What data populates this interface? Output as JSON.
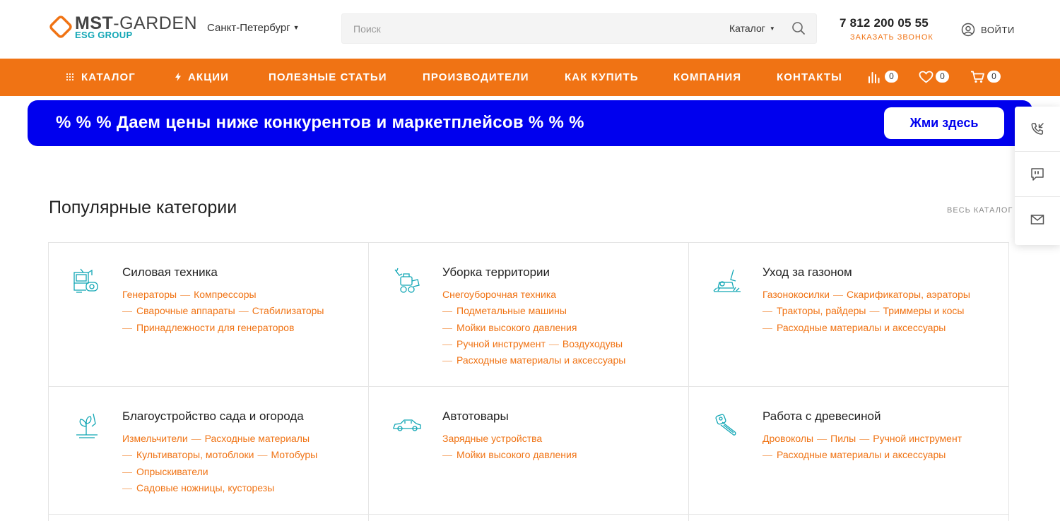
{
  "header": {
    "logo_main_bold": "MST",
    "logo_main_light": "-GARDEN",
    "logo_sub": "ESG GROUP",
    "city": "Санкт-Петербург",
    "search_placeholder": "Поиск",
    "search_category": "Каталог",
    "phone": "7 812 200 05 55",
    "callback": "ЗАКАЗАТЬ ЗВОНОК",
    "login": "ВОЙТИ"
  },
  "nav": {
    "items": [
      {
        "label": "КАТАЛОГ",
        "icon": "grid-dots-icon"
      },
      {
        "label": "АКЦИИ",
        "icon": "lightning-icon"
      },
      {
        "label": "ПОЛЕЗНЫЕ СТАТЬИ"
      },
      {
        "label": "ПРОИЗВОДИТЕЛИ"
      },
      {
        "label": "КАК КУПИТЬ"
      },
      {
        "label": "КОМПАНИЯ"
      },
      {
        "label": "КОНТАКТЫ"
      }
    ],
    "compare_count": "0",
    "favorites_count": "0",
    "cart_count": "0"
  },
  "banner": {
    "text": "% % % Даем цены ниже конкурентов и маркетплейсов % % %",
    "button": "Жми здесь"
  },
  "section": {
    "title": "Популярные категории",
    "all_link": "ВЕСЬ КАТАЛОГ"
  },
  "categories": [
    {
      "title": "Силовая техника",
      "icon": "generator-icon",
      "links": [
        [
          "Генераторы",
          "Компрессоры"
        ],
        [
          "Сварочные аппараты",
          "Стабилизаторы"
        ],
        [
          "Принадлежности для генераторов"
        ]
      ]
    },
    {
      "title": "Уборка территории",
      "icon": "snow-blower-icon",
      "links": [
        [
          "Снегоуборочная техника"
        ],
        [
          "Подметальные машины"
        ],
        [
          "Мойки высокого давления"
        ],
        [
          "Ручной инструмент",
          "Воздуходувы"
        ],
        [
          "Расходные материалы и аксессуары"
        ]
      ]
    },
    {
      "title": "Уход за газоном",
      "icon": "lawn-mower-icon",
      "links": [
        [
          "Газонокосилки",
          "Скарификаторы, аэраторы"
        ],
        [
          "Тракторы, райдеры",
          "Триммеры и косы"
        ],
        [
          "Расходные материалы и аксессуары"
        ]
      ]
    },
    {
      "title": "Благоустройство сада и огорода",
      "icon": "garden-plant-icon",
      "links": [
        [
          "Измельчители",
          "Расходные материалы"
        ],
        [
          "Культиваторы, мотоблоки",
          "Мотобуры"
        ],
        [
          "Опрыскиватели"
        ],
        [
          "Садовые ножницы, кусторезы"
        ]
      ]
    },
    {
      "title": "Автотовары",
      "icon": "car-icon",
      "links": [
        [
          "Зарядные устройства"
        ],
        [
          "Мойки высокого давления"
        ]
      ]
    },
    {
      "title": "Работа с древесиной",
      "icon": "chainsaw-icon",
      "links": [
        [
          "Дровоколы",
          "Пилы",
          "Ручной инструмент"
        ],
        [
          "Расходные материалы и аксессуары"
        ]
      ]
    }
  ],
  "colors": {
    "accent": "#f07314",
    "banner_bg": "#0000ee",
    "icon_teal": "#11a6b5"
  }
}
